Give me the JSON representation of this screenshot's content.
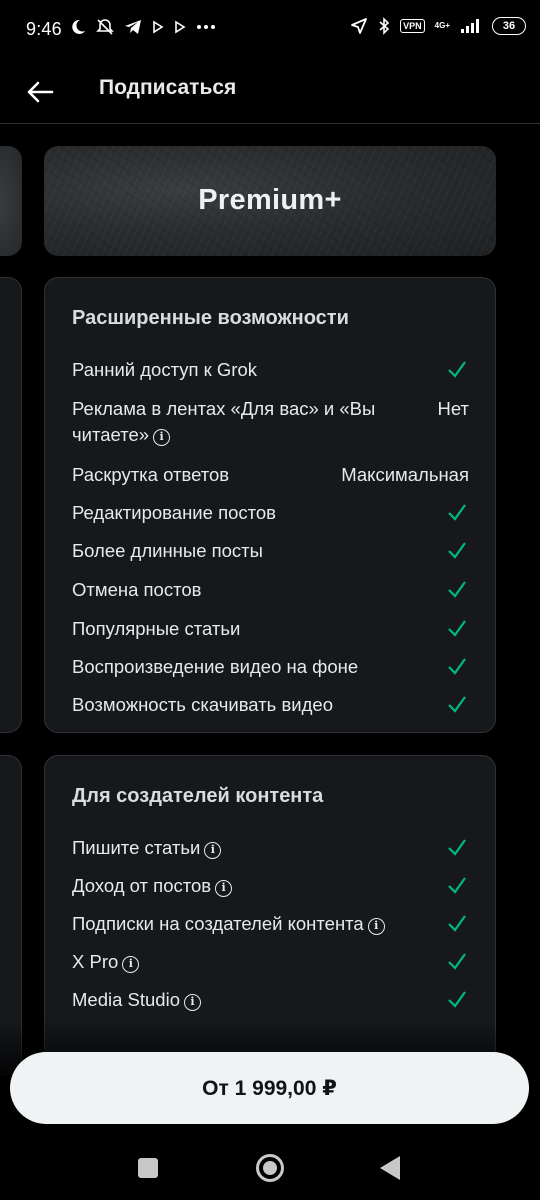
{
  "status_bar": {
    "time": "9:46",
    "vpn": "VPN",
    "network": "4G+",
    "battery": "36"
  },
  "header": {
    "title": "Подписаться"
  },
  "plan": {
    "name": "Premium+"
  },
  "features": {
    "title": "Расширенные возможности",
    "rows": [
      {
        "label": "Ранний доступ к Grok",
        "value": "check"
      },
      {
        "label": "Реклама в лентах «Для вас» и «Вы читаете»",
        "value": "Нет",
        "info": true
      },
      {
        "label": "Раскрутка ответов",
        "value": "Максимальная"
      },
      {
        "label": "Редактирование постов",
        "value": "check"
      },
      {
        "label": "Более длинные посты",
        "value": "check"
      },
      {
        "label": "Отмена постов",
        "value": "check"
      },
      {
        "label": "Популярные статьи",
        "value": "check"
      },
      {
        "label": "Воспроизведение видео на фоне",
        "value": "check"
      },
      {
        "label": "Возможность скачивать видео",
        "value": "check"
      }
    ]
  },
  "creators": {
    "title": "Для создателей контента",
    "rows": [
      {
        "label": "Пишите статьи",
        "value": "check",
        "info": true
      },
      {
        "label": "Доход от постов",
        "value": "check",
        "info": true
      },
      {
        "label": "Подписки на создателей контента",
        "value": "check",
        "info": true
      },
      {
        "label": "X Pro",
        "value": "check",
        "info": true
      },
      {
        "label": "Media Studio",
        "value": "check",
        "info": true
      }
    ]
  },
  "cta": {
    "label": "От 1 999,00 ₽"
  },
  "colors": {
    "check": "#00ba7c",
    "card_bg": "#16181c",
    "border": "#2f3336"
  }
}
